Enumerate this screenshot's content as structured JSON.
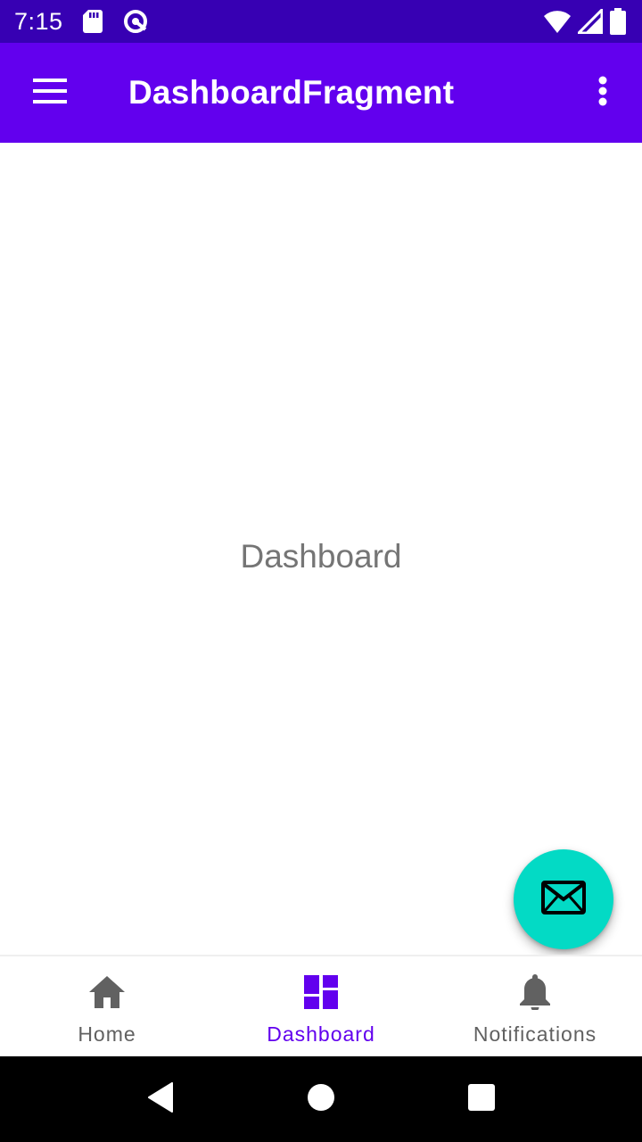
{
  "status_bar": {
    "time": "7:15",
    "icons": [
      "sd-card-icon",
      "data-saver-icon",
      "wifi-icon",
      "signal-icon",
      "battery-icon"
    ]
  },
  "app_bar": {
    "title": "DashboardFragment",
    "menu_icon": "hamburger-menu-icon",
    "overflow_icon": "more-vert-icon",
    "color": "#6200ee"
  },
  "content": {
    "text": "Dashboard"
  },
  "fab": {
    "icon": "email-icon",
    "color": "#03dac5"
  },
  "bottom_nav": {
    "items": [
      {
        "label": "Home",
        "icon": "home-icon",
        "active": false
      },
      {
        "label": "Dashboard",
        "icon": "dashboard-icon",
        "active": true
      },
      {
        "label": "Notifications",
        "icon": "bell-icon",
        "active": false
      }
    ],
    "active_color": "#6200ee",
    "inactive_color": "#616161"
  },
  "system_nav": {
    "buttons": [
      "back-icon",
      "home-circle-icon",
      "recents-icon"
    ]
  }
}
